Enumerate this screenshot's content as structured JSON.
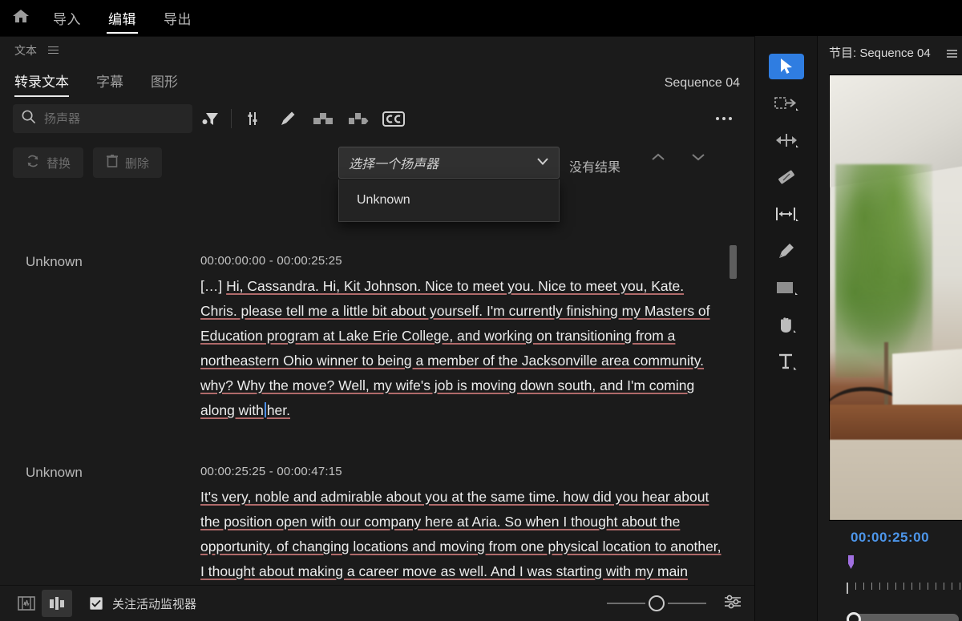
{
  "topbar": {
    "home_icon": "home-icon",
    "nav": [
      {
        "label": "导入",
        "active": false
      },
      {
        "label": "编辑",
        "active": true
      },
      {
        "label": "导出",
        "active": false
      }
    ]
  },
  "text_panel": {
    "panel_label": "文本",
    "panel_menu_icon": "hamburger-icon",
    "tabs": [
      {
        "label": "转录文本",
        "active": true
      },
      {
        "label": "字幕",
        "active": false
      },
      {
        "label": "图形",
        "active": false
      }
    ],
    "sequence_name": "Sequence 04",
    "toolbar": {
      "search_placeholder": "扬声器",
      "search_value": "",
      "search_icon": "search-icon",
      "filter_icon": "filter-funnel-icon",
      "sliders_icon": "sliders-icon",
      "pencil_icon": "pencil-icon",
      "merge_clips_icon": "merge-clips-icon",
      "split_clip_icon": "split-clip-icon",
      "captions_icon": "cc-icon",
      "more_icon": "more-options-icon"
    },
    "actions": {
      "replace_label": "替换",
      "replace_icon": "refresh-icon",
      "delete_label": "删除",
      "delete_icon": "trash-icon",
      "speaker_select_value": "选择一个扬声器",
      "speaker_select_chevron": "chevron-down-icon",
      "speaker_options": [
        "Unknown"
      ],
      "results_label": "没有结果",
      "prev_icon": "chevron-up-icon",
      "next_icon": "chevron-down-icon"
    },
    "transcript": [
      {
        "speaker": "Unknown",
        "time": "00:00:00:00 - 00:00:25:25",
        "prefix": "[…]",
        "text": "Hi, Cassandra. Hi, Kit Johnson. Nice to meet you. Nice to meet you, Kate. Chris. please tell me a little bit about yourself. I'm currently finishing my Masters of Education program at Lake Erie College, and working on transitioning from a northeastern Ohio winner to being a member of the Jacksonville area community. why? Why the move? Well, my wife's job is moving down south, and I'm coming along with",
        "text_after_caret": "her.",
        "has_caret": true
      },
      {
        "speaker": "Unknown",
        "time": "00:00:25:25 - 00:00:47:15",
        "prefix": "",
        "text": "It's very, noble and admirable about you at the same time. how did you hear about the position open with our company here at Aria. So when I thought about the opportunity, of changing locations and moving from one physical location to another, I thought about making a career move as well. And I was starting with my main interest in passions",
        "text_after_caret": "",
        "has_caret": false
      }
    ],
    "bottom_bar": {
      "view_list_icon": "transcript-view-icon",
      "view_grid_icon": "caption-view-icon",
      "follow_checkbox_checked": true,
      "follow_label": "关注活动监视器",
      "zoom_slider_value": 33,
      "settings_icon": "settings-sliders-icon"
    }
  },
  "tool_strip": [
    {
      "name": "selection-tool",
      "active": true
    },
    {
      "name": "track-select-forward-tool",
      "active": false
    },
    {
      "name": "ripple-edit-tool",
      "active": false
    },
    {
      "name": "razor-tool",
      "active": false
    },
    {
      "name": "slip-tool",
      "active": false
    },
    {
      "name": "pen-tool",
      "active": false
    },
    {
      "name": "rectangle-tool",
      "active": false
    },
    {
      "name": "hand-tool",
      "active": false
    },
    {
      "name": "type-tool",
      "active": false
    }
  ],
  "monitor": {
    "title": "节目: Sequence 04",
    "menu_icon": "hamburger-icon",
    "timecode": "00:00:25:00",
    "timecode_color": "#4d96ea",
    "playhead_color": "#a06fe0"
  }
}
